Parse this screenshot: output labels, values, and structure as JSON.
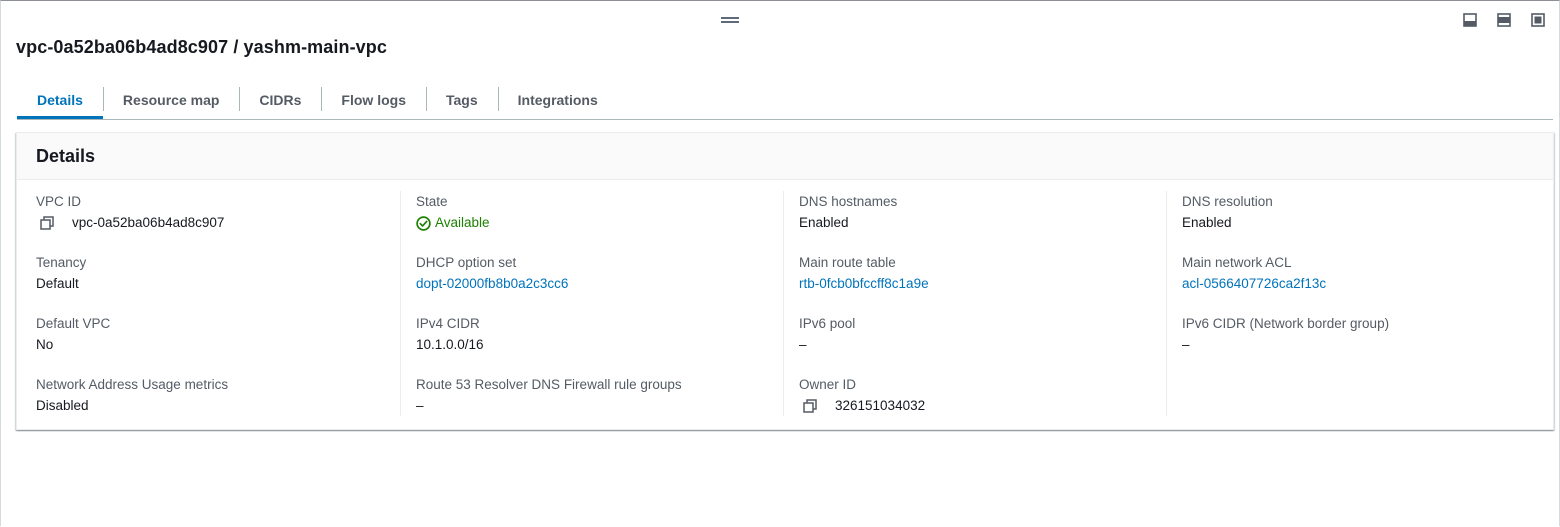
{
  "window": {
    "title": "vpc-0a52ba06b4ad8c907 / yashm-main-vpc",
    "controls": [
      "panel-bottom-icon",
      "panel-side-icon",
      "panel-maximize-icon"
    ]
  },
  "tabs": [
    {
      "label": "Details",
      "active": true
    },
    {
      "label": "Resource map",
      "active": false
    },
    {
      "label": "CIDRs",
      "active": false
    },
    {
      "label": "Flow logs",
      "active": false
    },
    {
      "label": "Tags",
      "active": false
    },
    {
      "label": "Integrations",
      "active": false
    }
  ],
  "details": {
    "heading": "Details",
    "columns": [
      [
        {
          "label": "VPC ID",
          "value": "vpc-0a52ba06b4ad8c907",
          "kind": "copy"
        },
        {
          "label": "Tenancy",
          "value": "Default",
          "kind": "text"
        },
        {
          "label": "Default VPC",
          "value": "No",
          "kind": "text"
        },
        {
          "label": "Network Address Usage metrics",
          "value": "Disabled",
          "kind": "text"
        }
      ],
      [
        {
          "label": "State",
          "value": "Available",
          "kind": "status"
        },
        {
          "label": "DHCP option set",
          "value": "dopt-02000fb8b0a2c3cc6",
          "kind": "link"
        },
        {
          "label": "IPv4 CIDR",
          "value": "10.1.0.0/16",
          "kind": "text"
        },
        {
          "label": "Route 53 Resolver DNS Firewall rule groups",
          "value": "–",
          "kind": "text"
        }
      ],
      [
        {
          "label": "DNS hostnames",
          "value": "Enabled",
          "kind": "text"
        },
        {
          "label": "Main route table",
          "value": "rtb-0fcb0bfccff8c1a9e",
          "kind": "link"
        },
        {
          "label": "IPv6 pool",
          "value": "–",
          "kind": "text"
        },
        {
          "label": "Owner ID",
          "value": "326151034032",
          "kind": "copy"
        }
      ],
      [
        {
          "label": "DNS resolution",
          "value": "Enabled",
          "kind": "text"
        },
        {
          "label": "Main network ACL",
          "value": "acl-0566407726ca2f13c",
          "kind": "link"
        },
        {
          "label": "IPv6 CIDR (Network border group)",
          "value": "–",
          "kind": "text"
        }
      ]
    ]
  },
  "colors": {
    "link": "#0073bb",
    "status_ok": "#1d8102",
    "label": "#545b64",
    "text": "#16191f"
  }
}
